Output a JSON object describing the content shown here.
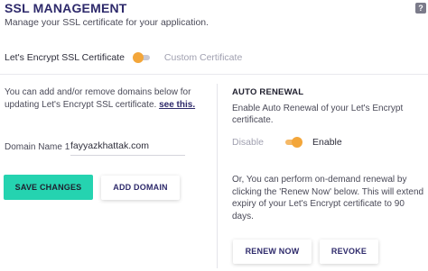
{
  "header": {
    "title": "SSL MANAGEMENT",
    "help_glyph": "?",
    "subtitle": "Manage your SSL certificate for your application."
  },
  "certificate_type": {
    "left_label": "Let's Encrypt SSL Certificate",
    "right_label": "Custom Certificate",
    "selected": "Let's Encrypt SSL Certificate"
  },
  "domains": {
    "info_text": "You can add and/or remove domains below for updating Let's Encrypt SSL certificate.",
    "info_link": "see this.",
    "field_label": "Domain Name 1",
    "field_value": "fayyazkhattak.com",
    "save_label": "SAVE CHANGES",
    "add_label": "ADD DOMAIN"
  },
  "auto_renewal": {
    "title": "AUTO RENEWAL",
    "description": "Enable Auto Renewal of your Let's Encrypt certificate.",
    "off_label": "Disable",
    "on_label": "Enable",
    "enabled": true,
    "renew_text": "Or, You can perform on-demand renewal by clicking the 'Renew Now' below. This will extend expiry of your Let's Encrypt certificate to 90 days.",
    "renew_label": "RENEW NOW",
    "revoke_label": "REVOKE"
  },
  "colors": {
    "accent_orange": "#f3a63a",
    "primary_teal": "#25d3b0",
    "heading_navy": "#2e2a6b"
  }
}
